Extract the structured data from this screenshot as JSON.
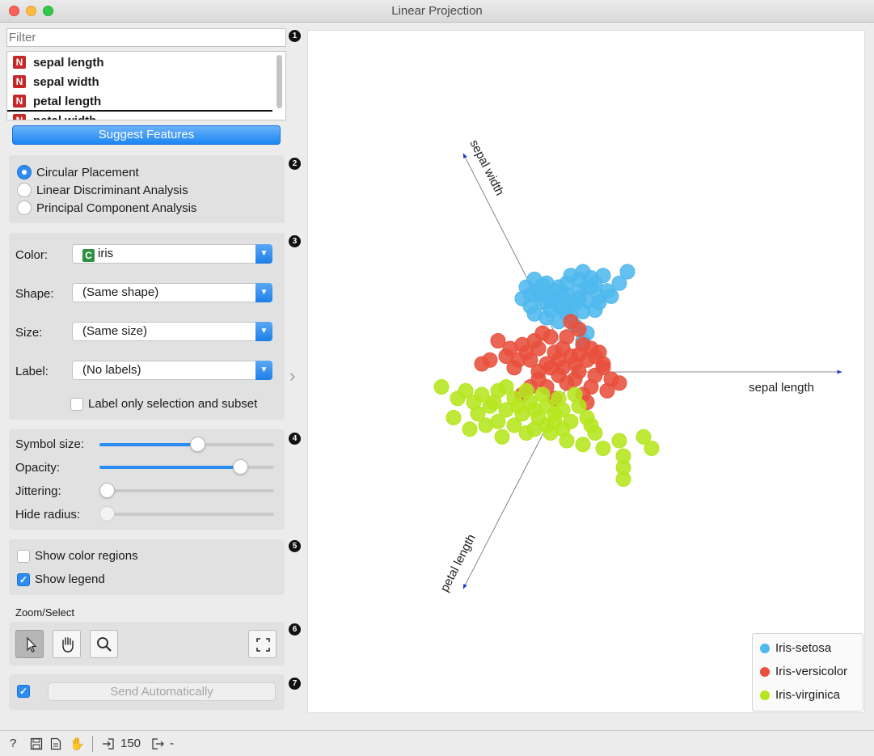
{
  "window": {
    "title": "Linear Projection"
  },
  "filter": {
    "placeholder": "Filter"
  },
  "variables": [
    {
      "type": "N",
      "name": "sepal length"
    },
    {
      "type": "N",
      "name": "sepal width"
    },
    {
      "type": "N",
      "name": "petal length"
    },
    {
      "type": "N",
      "name": "petal width"
    }
  ],
  "suggest_button": "Suggest Features",
  "badges": [
    "1",
    "2",
    "3",
    "4",
    "5",
    "6",
    "7"
  ],
  "placement": {
    "options": [
      "Circular Placement",
      "Linear Discriminant Analysis",
      "Principal Component Analysis"
    ],
    "selected": "Circular Placement"
  },
  "attributes": {
    "color_label": "Color:",
    "color_value": "iris",
    "color_type": "C",
    "shape_label": "Shape:",
    "shape_value": "(Same shape)",
    "size_label": "Size:",
    "size_value": "(Same size)",
    "label_label": "Label:",
    "label_value": "(No labels)",
    "label_only_selection": "Label only selection and subset"
  },
  "sliders": {
    "symbol_size": {
      "label": "Symbol size:",
      "value": 0.57
    },
    "opacity": {
      "label": "Opacity:",
      "value": 0.84
    },
    "jittering": {
      "label": "Jittering:",
      "value": 0.0
    },
    "hide_radius": {
      "label": "Hide radius:",
      "value": 0.0
    }
  },
  "display": {
    "show_color_regions": "Show color regions",
    "show_color_regions_checked": false,
    "show_legend": "Show legend",
    "show_legend_checked": true
  },
  "zoom_select": {
    "title": "Zoom/Select"
  },
  "commit": {
    "auto_checked": true,
    "button": "Send Automatically"
  },
  "plot": {
    "axes": [
      "sepal length",
      "sepal width",
      "petal length"
    ]
  },
  "legend": [
    {
      "label": "Iris-setosa",
      "color": "#4fb8ee"
    },
    {
      "label": "Iris-versicolor",
      "color": "#e8503c"
    },
    {
      "label": "Iris-virginica",
      "color": "#b5e61d"
    }
  ],
  "status": {
    "input_count": "150",
    "output": "-"
  },
  "chart_data": {
    "type": "scatter",
    "title": "",
    "xlabel": "",
    "ylabel": "",
    "grid": false,
    "legend_position": "bottom-right",
    "series": [
      {
        "name": "Iris-setosa",
        "color": "#4fb8ee",
        "points": [
          [
            0.05,
            1.0
          ],
          [
            0.15,
            1.1
          ],
          [
            0.3,
            1.05
          ],
          [
            0.45,
            1.0
          ],
          [
            0.2,
            0.9
          ],
          [
            0.0,
            0.85
          ],
          [
            0.1,
            0.75
          ],
          [
            0.25,
            0.8
          ],
          [
            0.4,
            0.85
          ],
          [
            0.55,
            0.9
          ],
          [
            0.7,
            0.95
          ],
          [
            0.85,
            1.0
          ],
          [
            1.0,
            1.15
          ],
          [
            1.2,
            1.05
          ],
          [
            0.6,
            1.15
          ],
          [
            0.75,
            1.2
          ],
          [
            0.35,
            0.7
          ],
          [
            0.5,
            0.72
          ],
          [
            0.65,
            0.78
          ],
          [
            0.8,
            0.82
          ],
          [
            0.95,
            0.88
          ],
          [
            0.15,
            0.65
          ],
          [
            0.3,
            0.6
          ],
          [
            0.45,
            0.55
          ],
          [
            0.6,
            0.62
          ],
          [
            0.75,
            0.68
          ],
          [
            0.9,
            0.7
          ],
          [
            0.2,
            0.95
          ],
          [
            0.55,
            1.05
          ],
          [
            0.7,
            1.1
          ],
          [
            0.85,
            1.12
          ],
          [
            0.4,
            0.95
          ],
          [
            0.65,
            0.5
          ],
          [
            0.8,
            0.4
          ],
          [
            0.75,
            0.3
          ],
          [
            1.05,
            0.95
          ],
          [
            1.1,
            0.88
          ],
          [
            0.95,
            0.8
          ],
          [
            0.1,
            0.9
          ],
          [
            0.25,
            1.02
          ],
          [
            0.5,
            0.88
          ],
          [
            0.6,
            0.8
          ],
          [
            0.35,
            0.82
          ],
          [
            0.9,
            1.05
          ],
          [
            0.7,
            0.85
          ],
          [
            0.45,
            0.75
          ],
          [
            0.8,
            1.0
          ],
          [
            1.3,
            1.2
          ],
          [
            0.55,
            0.65
          ],
          [
            0.3,
            0.9
          ]
        ]
      },
      {
        "name": "Iris-versicolor",
        "color": "#e8503c",
        "points": [
          [
            -0.3,
            0.3
          ],
          [
            0.0,
            0.25
          ],
          [
            0.2,
            0.2
          ],
          [
            0.4,
            0.15
          ],
          [
            0.6,
            0.1
          ],
          [
            0.8,
            0.05
          ],
          [
            1.0,
            0.0
          ],
          [
            -0.2,
            0.1
          ],
          [
            0.1,
            0.05
          ],
          [
            0.3,
            0.0
          ],
          [
            0.5,
            -0.05
          ],
          [
            0.7,
            -0.1
          ],
          [
            0.9,
            -0.15
          ],
          [
            1.1,
            -0.2
          ],
          [
            -0.4,
            0.05
          ],
          [
            -0.1,
            -0.05
          ],
          [
            0.2,
            -0.1
          ],
          [
            0.45,
            -0.15
          ],
          [
            0.65,
            -0.2
          ],
          [
            0.85,
            -0.3
          ],
          [
            1.05,
            -0.35
          ],
          [
            0.3,
            -0.3
          ],
          [
            0.0,
            -0.4
          ],
          [
            0.55,
            0.35
          ],
          [
            0.75,
            0.25
          ],
          [
            0.95,
            0.15
          ],
          [
            0.7,
            0.45
          ],
          [
            0.6,
            0.55
          ],
          [
            0.15,
            0.3
          ],
          [
            0.35,
            0.35
          ],
          [
            -0.5,
            0.0
          ],
          [
            0.4,
            -0.45
          ],
          [
            0.8,
            -0.5
          ],
          [
            1.2,
            -0.25
          ],
          [
            0.25,
            0.4
          ],
          [
            0.5,
            0.2
          ],
          [
            0.05,
            0.15
          ],
          [
            0.9,
            0.1
          ],
          [
            0.65,
            0.0
          ],
          [
            0.45,
            0.05
          ],
          [
            -0.15,
            0.2
          ],
          [
            1.0,
            -0.05
          ],
          [
            0.75,
            -0.4
          ],
          [
            0.2,
            -0.2
          ],
          [
            0.55,
            -0.25
          ],
          [
            0.35,
            -0.05
          ],
          [
            0.85,
            0.2
          ],
          [
            0.1,
            -0.3
          ],
          [
            -0.05,
            0.05
          ],
          [
            0.7,
            0.12
          ]
        ]
      },
      {
        "name": "Iris-virginica",
        "color": "#b5e61d",
        "points": [
          [
            -1.0,
            -0.3
          ],
          [
            -0.7,
            -0.35
          ],
          [
            -0.5,
            -0.4
          ],
          [
            -0.3,
            -0.35
          ],
          [
            -0.1,
            -0.45
          ],
          [
            0.1,
            -0.5
          ],
          [
            0.3,
            -0.55
          ],
          [
            0.5,
            -0.6
          ],
          [
            0.7,
            -0.55
          ],
          [
            -0.6,
            -0.5
          ],
          [
            -0.4,
            -0.55
          ],
          [
            -0.2,
            -0.6
          ],
          [
            0.0,
            -0.65
          ],
          [
            0.2,
            -0.7
          ],
          [
            0.4,
            -0.65
          ],
          [
            0.6,
            -0.75
          ],
          [
            0.8,
            -0.7
          ],
          [
            -0.8,
            -0.45
          ],
          [
            -0.55,
            -0.65
          ],
          [
            -0.3,
            -0.75
          ],
          [
            -0.1,
            -0.8
          ],
          [
            0.15,
            -0.85
          ],
          [
            0.35,
            -0.9
          ],
          [
            0.55,
            -1.0
          ],
          [
            0.75,
            -1.05
          ],
          [
            1.0,
            -1.1
          ],
          [
            1.2,
            -1.0
          ],
          [
            1.5,
            -0.95
          ],
          [
            1.6,
            -1.1
          ],
          [
            1.25,
            -1.2
          ],
          [
            1.25,
            -1.35
          ],
          [
            1.25,
            -1.5
          ],
          [
            -0.85,
            -0.7
          ],
          [
            -0.2,
            -0.3
          ],
          [
            0.05,
            -0.35
          ],
          [
            0.25,
            -0.4
          ],
          [
            0.45,
            -0.45
          ],
          [
            0.65,
            -0.4
          ],
          [
            -0.45,
            -0.8
          ],
          [
            -0.65,
            -0.85
          ],
          [
            0.05,
            -0.9
          ],
          [
            0.3,
            -0.8
          ],
          [
            0.5,
            -0.85
          ],
          [
            0.9,
            -0.9
          ],
          [
            -0.35,
            -0.5
          ],
          [
            0.15,
            -0.6
          ],
          [
            -0.05,
            -0.55
          ],
          [
            0.4,
            -0.75
          ],
          [
            0.85,
            -0.8
          ],
          [
            -0.25,
            -0.95
          ]
        ]
      }
    ]
  }
}
